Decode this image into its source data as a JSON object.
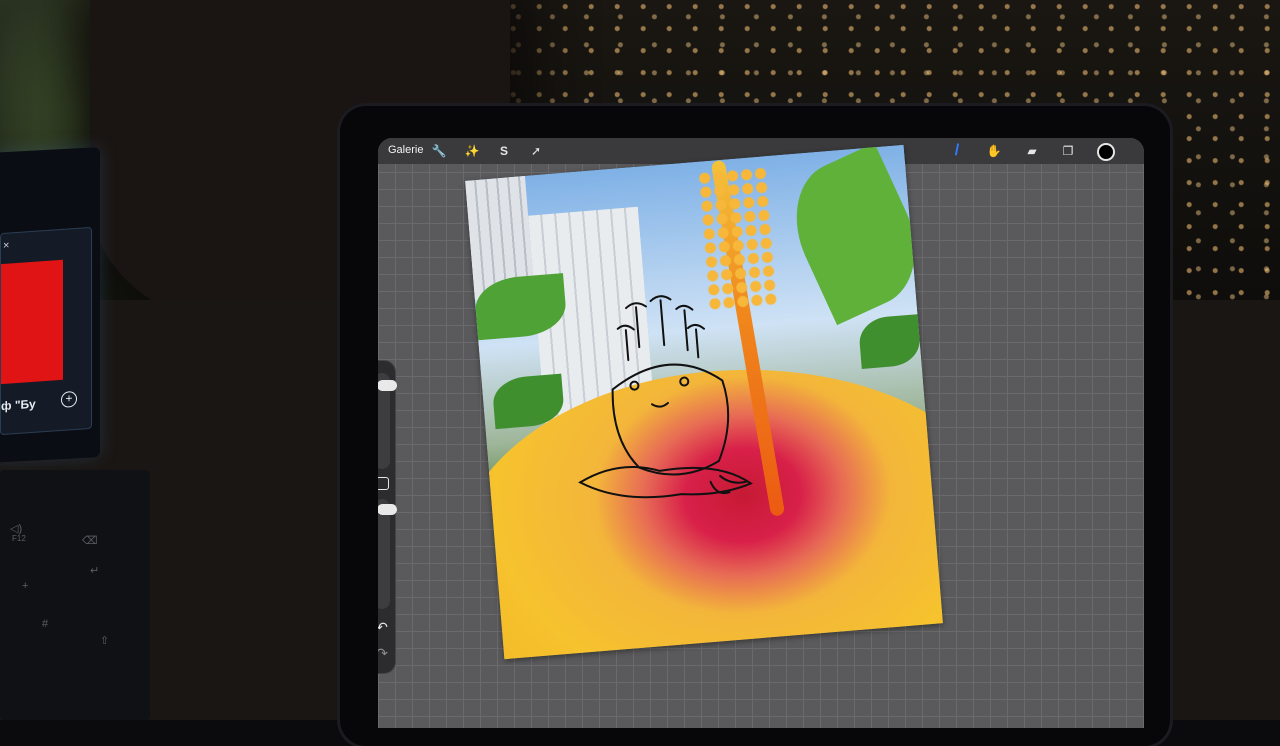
{
  "toolbar": {
    "gallery_label": "Galerie",
    "left_tools": [
      {
        "name": "actions-wrench-icon",
        "glyph": "🔧"
      },
      {
        "name": "adjustments-wand-icon",
        "glyph": "✨"
      },
      {
        "name": "selection-s-icon",
        "glyph": "S"
      },
      {
        "name": "transform-arrow-icon",
        "glyph": "➚"
      }
    ],
    "right_tools": [
      {
        "name": "brush-icon",
        "glyph": "/"
      },
      {
        "name": "smudge-icon",
        "glyph": "✋"
      },
      {
        "name": "eraser-icon",
        "glyph": "▰"
      },
      {
        "name": "layers-icon",
        "glyph": "❐"
      }
    ],
    "active_color": "#000000",
    "brush_active_color": "#2f7dff"
  },
  "sidebar": {
    "brush_size_level": 0.08,
    "opacity_level": 0.05,
    "undo_glyph": "↶",
    "redo_glyph": "↷"
  },
  "laptop": {
    "close_glyph": "×",
    "chars": "ф \"Бу",
    "plus_glyph": "+",
    "accent_color": "#e01414"
  },
  "keyboard": {
    "keys": [
      "◁)",
      "F12",
      "⌫",
      "↵",
      "+",
      "#",
      "⇧"
    ]
  }
}
